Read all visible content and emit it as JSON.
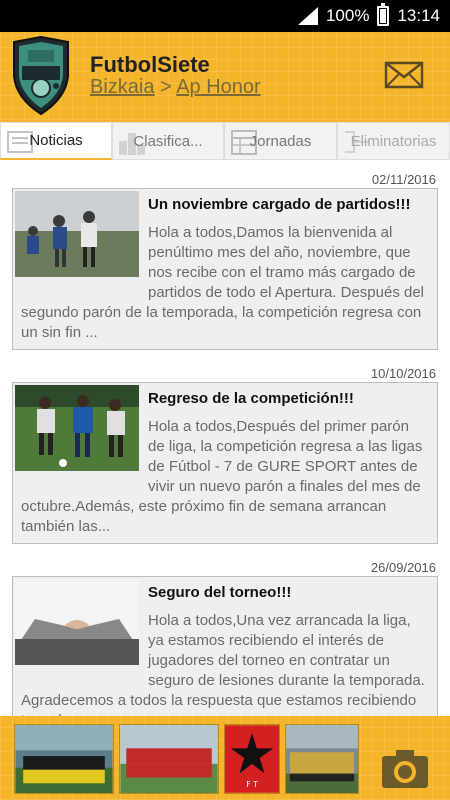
{
  "status_bar": {
    "battery": "100%",
    "time": "13:14"
  },
  "header": {
    "title": "FutbolSiete",
    "breadcrumb_region": "Bizkaia",
    "breadcrumb_sep": ">",
    "breadcrumb_league": "Ap Honor"
  },
  "tabs": [
    {
      "label": "Noticias",
      "active": true
    },
    {
      "label": "Clasifica...",
      "active": false
    },
    {
      "label": "Jornadas",
      "active": false
    },
    {
      "label": "Eliminatorias",
      "active": false
    }
  ],
  "articles": [
    {
      "date": "02/11/2016",
      "title": "Un noviembre cargado de partidos!!!",
      "body": "Hola a todos,Damos la bienvenida al penúltimo mes del año, noviembre, que nos recibe con el tramo más cargado de partidos de todo el Apertura. Después del segundo parón de la temporada, la competición regresa con un sin fin ..."
    },
    {
      "date": "10/10/2016",
      "title": "Regreso de la competición!!!",
      "body": "Hola a todos,Después del primer parón de liga, la competición regresa a las ligas de Fútbol - 7 de GURE SPORT antes de vivir un nuevo parón a finales del mes de octubre.Además, este próximo fin de semana arrancan también las..."
    },
    {
      "date": "26/09/2016",
      "title": "Seguro del torneo!!!",
      "body": "Hola a todos,Una vez arrancada la liga, ya estamos recibiendo el interés de jugadores del torneo en contratar un seguro de lesiones durante la temporada. Agradecemos a todos la respuesta que estamos recibiendo tras el"
    }
  ],
  "gallery_logo_text": "F T",
  "colors": {
    "brand": "#f5b52b",
    "card_bg": "#efefef",
    "text_muted": "#6a6a6a"
  }
}
